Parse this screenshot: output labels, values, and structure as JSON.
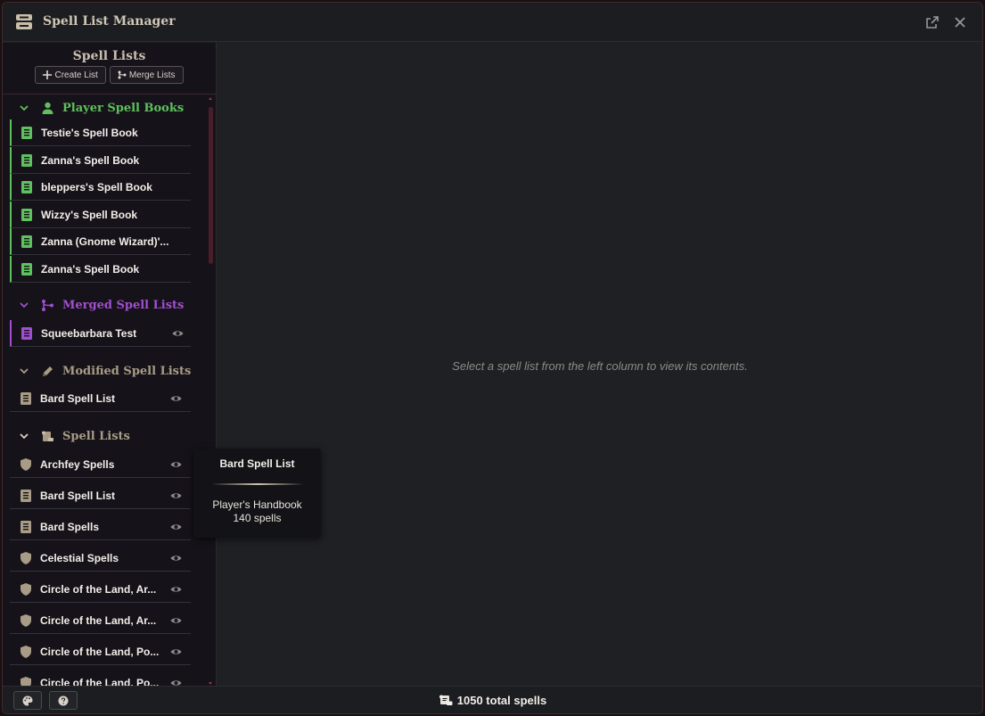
{
  "window": {
    "title": "Spell List Manager"
  },
  "sidebar": {
    "title": "Spell Lists",
    "create_label": "Create List",
    "merge_label": "Merge Lists",
    "sections": [
      {
        "label": "Player Spell Books",
        "color": "#5ec15e",
        "icon": "user-icon",
        "items": [
          {
            "label": "Testie's Spell Book"
          },
          {
            "label": "Zanna's Spell Book"
          },
          {
            "label": "bleppers's Spell Book"
          },
          {
            "label": "Wizzy's Spell Book"
          },
          {
            "label": "Zanna (Gnome Wizard)'..."
          },
          {
            "label": "Zanna's Spell Book"
          }
        ]
      },
      {
        "label": "Merged Spell Lists",
        "color": "#a04fd0",
        "icon": "merge-icon",
        "items": [
          {
            "label": "Squeebarbara Test"
          }
        ]
      },
      {
        "label": "Modified Spell Lists",
        "color": "#a89c86",
        "icon": "pencil-icon",
        "items": [
          {
            "label": "Bard Spell List"
          }
        ]
      },
      {
        "label": "Spell Lists",
        "color": "#a89c86",
        "icon": "scroll-icon",
        "items": [
          {
            "label": "Archfey Spells"
          },
          {
            "label": "Bard Spell List"
          },
          {
            "label": "Bard Spells"
          },
          {
            "label": "Celestial Spells"
          },
          {
            "label": "Circle of the Land, Ar..."
          },
          {
            "label": "Circle of the Land, Ar..."
          },
          {
            "label": "Circle of the Land, Po..."
          },
          {
            "label": "Circle of the Land, Po..."
          }
        ]
      }
    ]
  },
  "main": {
    "empty_message": "Select a spell list from the left column to view its contents."
  },
  "tooltip": {
    "title": "Bard Spell List",
    "source": "Player's Handbook",
    "count": "140 spells"
  },
  "footer": {
    "total": "1050 total spells"
  },
  "colors": {
    "accent_green": "#5ec15e",
    "accent_purple": "#a04fd0",
    "muted_tan": "#a89c86"
  }
}
